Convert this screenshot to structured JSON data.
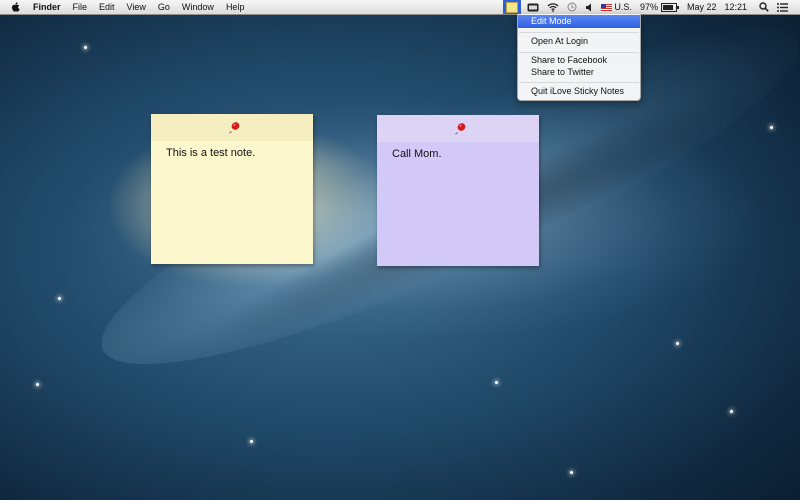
{
  "menubar": {
    "app_name": "Finder",
    "menus": [
      "File",
      "Edit",
      "View",
      "Go",
      "Window",
      "Help"
    ],
    "status": {
      "input_source": "U.S.",
      "battery_percent": "97%",
      "date": "May 22",
      "time": "12:21"
    }
  },
  "dropdown": {
    "items": [
      "Edit Mode",
      "Open At Login",
      "Share to Facebook",
      "Share to Twitter",
      "Quit iLove Sticky Notes"
    ],
    "selected": "Edit Mode"
  },
  "notes": [
    {
      "text": "This is a test note.",
      "color": "#fcf7cd"
    },
    {
      "text": "Call Mom.",
      "color": "#d3c9f8"
    }
  ],
  "colors": {
    "menu_highlight": "#2f5fe0",
    "pin": "#d21b1b"
  }
}
